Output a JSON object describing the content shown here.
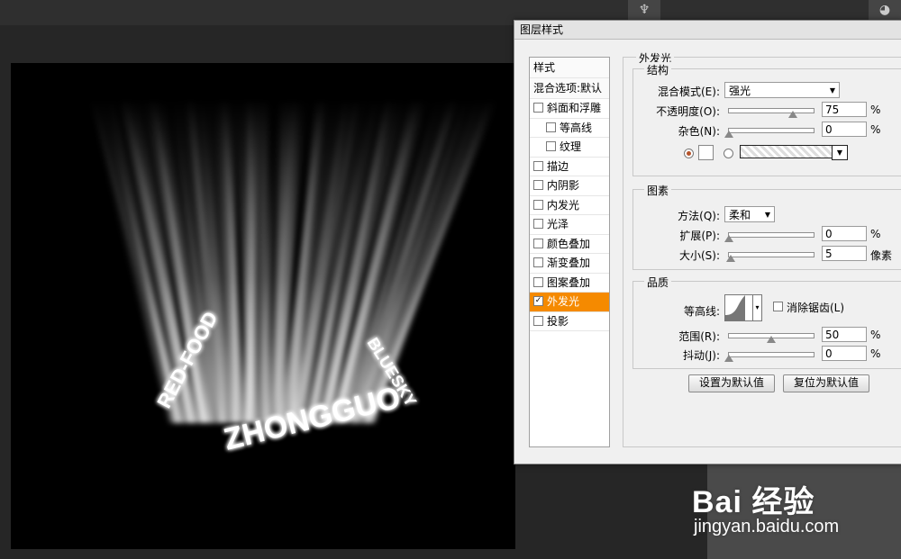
{
  "dialog": {
    "title": "图层样式",
    "style_list": {
      "header": "样式",
      "blend_default": "混合选项:默认",
      "items": [
        {
          "label": "斜面和浮雕",
          "checked": false,
          "indent": false
        },
        {
          "label": "等高线",
          "checked": false,
          "indent": true
        },
        {
          "label": "纹理",
          "checked": false,
          "indent": true
        },
        {
          "label": "描边",
          "checked": false,
          "indent": false
        },
        {
          "label": "内阴影",
          "checked": false,
          "indent": false
        },
        {
          "label": "内发光",
          "checked": false,
          "indent": false
        },
        {
          "label": "光泽",
          "checked": false,
          "indent": false
        },
        {
          "label": "颜色叠加",
          "checked": false,
          "indent": false
        },
        {
          "label": "渐变叠加",
          "checked": false,
          "indent": false
        },
        {
          "label": "图案叠加",
          "checked": false,
          "indent": false
        },
        {
          "label": "外发光",
          "checked": true,
          "indent": false,
          "active": true
        },
        {
          "label": "投影",
          "checked": false,
          "indent": false
        }
      ]
    },
    "panel_title": "外发光",
    "structure": {
      "title": "结构",
      "blend_mode_label": "混合模式(E):",
      "blend_mode_value": "强光",
      "opacity_label": "不透明度(O):",
      "opacity_value": "75",
      "opacity_fraction": 0.75,
      "noise_label": "杂色(N):",
      "noise_value": "0",
      "noise_fraction": 0,
      "percent": "%"
    },
    "elements": {
      "title": "图素",
      "method_label": "方法(Q):",
      "method_value": "柔和",
      "spread_label": "扩展(P):",
      "spread_value": "0",
      "spread_fraction": 0,
      "size_label": "大小(S):",
      "size_value": "5",
      "size_fraction": 0.02,
      "percent": "%",
      "px_unit": "像素"
    },
    "quality": {
      "title": "品质",
      "contour_label": "等高线:",
      "antialias_label": "消除锯齿(L)",
      "range_label": "范围(R):",
      "range_value": "50",
      "range_fraction": 0.5,
      "jitter_label": "抖动(J):",
      "jitter_value": "0",
      "jitter_fraction": 0,
      "percent": "%"
    },
    "buttons": {
      "set_default": "设置为默认值",
      "reset_default": "复位为默认值"
    }
  },
  "canvas": {
    "ring_text_top_left": "RED-FOOD",
    "ring_text_top_right": "BLUESKY",
    "ring_text_bottom": "ZHONGGUO"
  },
  "watermark": {
    "logo": "Bai 经验",
    "url": "jingyan.baidu.com"
  }
}
